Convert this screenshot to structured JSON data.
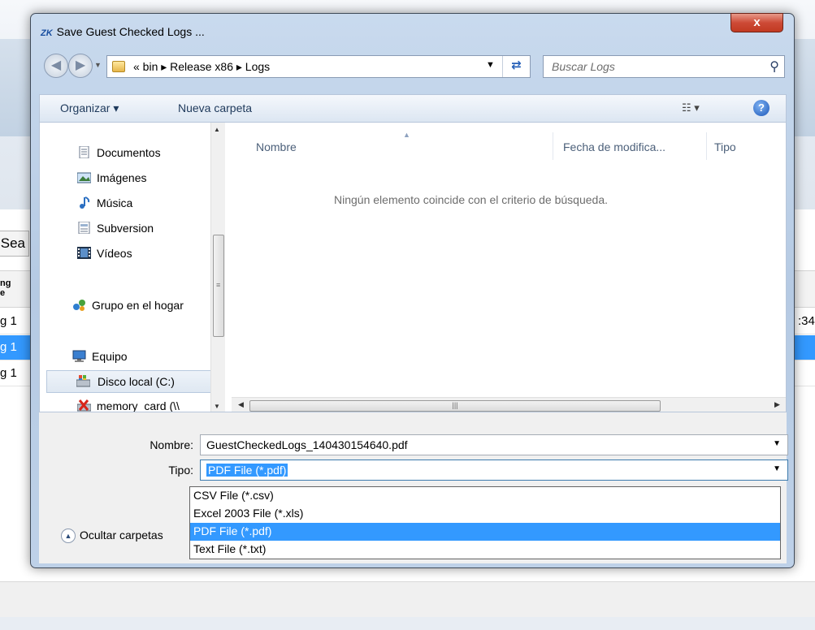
{
  "background": {
    "search_label": "Sea",
    "header_text": "ng\ne",
    "rows": [
      {
        "label": "g 1",
        "extra": ":34",
        "selected": false
      },
      {
        "label": "g 1",
        "extra": "",
        "selected": true
      },
      {
        "label": "g 1",
        "extra": "",
        "selected": false
      }
    ]
  },
  "dialog": {
    "app_logo": "ZK",
    "title": "Save Guest Checked Logs ...",
    "close_label": "x",
    "address": {
      "breadcrumbs": "«  bin  ▸  Release x86  ▸  Logs"
    },
    "search": {
      "placeholder": "Buscar Logs"
    },
    "toolbar": {
      "organize_label": "Organizar ▾",
      "new_folder_label": "Nueva carpeta",
      "view_label": "☷ ▾",
      "help_label": "?"
    },
    "nav_items": [
      {
        "label": "Documentos",
        "icon": "documents-icon"
      },
      {
        "label": "Imágenes",
        "icon": "pictures-icon"
      },
      {
        "label": "Música",
        "icon": "music-icon"
      },
      {
        "label": "Subversion",
        "icon": "subversion-icon"
      },
      {
        "label": "Vídeos",
        "icon": "videos-icon"
      },
      {
        "label": "Grupo en el hogar",
        "icon": "homegroup-icon"
      },
      {
        "label": "Equipo",
        "icon": "computer-icon"
      },
      {
        "label": "Disco local (C:)",
        "icon": "local-disk-icon"
      },
      {
        "label": "memory_card (\\\\",
        "icon": "network-drive-icon"
      }
    ],
    "columns": [
      "Nombre",
      "Fecha de modifica...",
      "Tipo"
    ],
    "empty_message": "Ningún elemento coincide con el criterio de búsqueda.",
    "filename_label": "Nombre:",
    "filename_value": "GuestCheckedLogs_140430154640.pdf",
    "type_label": "Tipo:",
    "type_value": "PDF File (*.pdf)",
    "type_options": [
      "CSV File (*.csv)",
      "Excel 2003 File (*.xls)",
      "PDF File (*.pdf)",
      "Text File (*.txt)"
    ],
    "selected_type_index": 2,
    "hide_folders_label": "Ocultar carpetas"
  }
}
